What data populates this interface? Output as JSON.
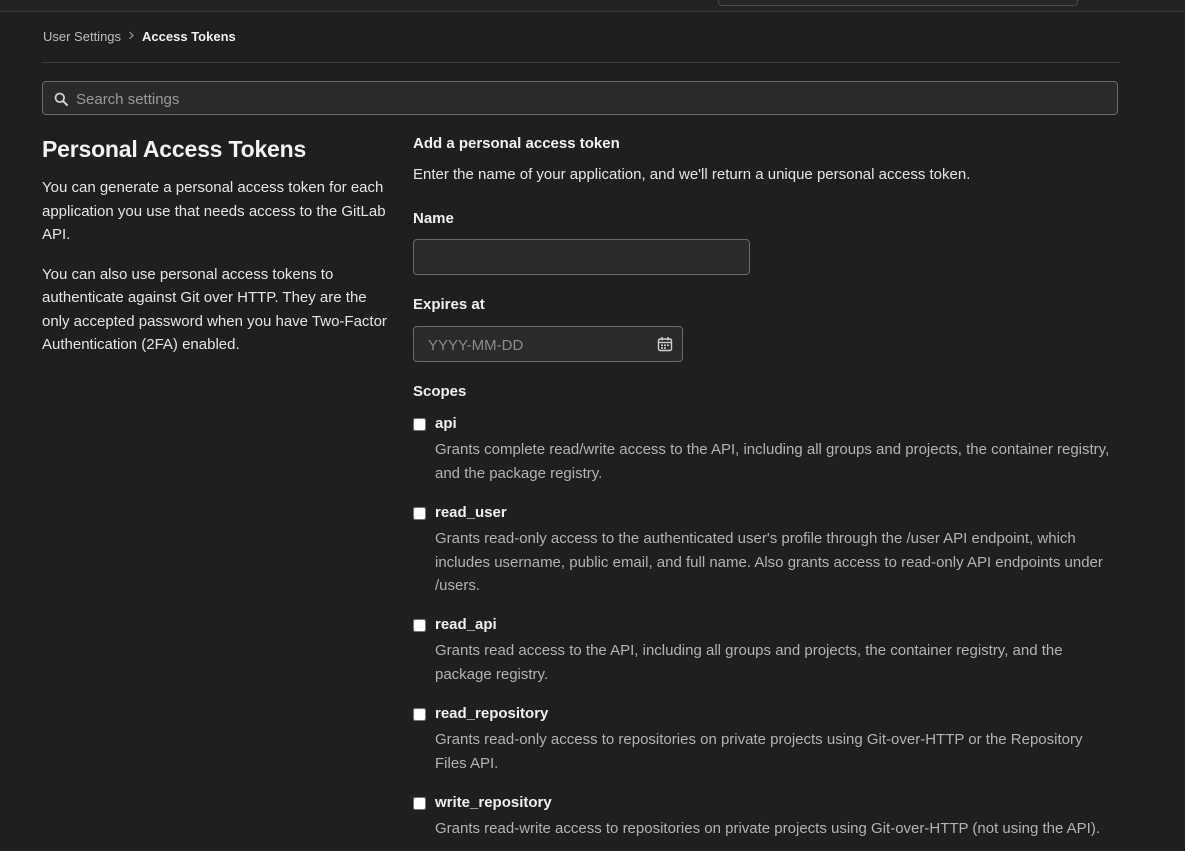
{
  "breadcrumb": {
    "parent": "User Settings",
    "current": "Access Tokens"
  },
  "search": {
    "placeholder": "Search settings",
    "value": ""
  },
  "intro": {
    "title": "Personal Access Tokens",
    "paragraphs": [
      "You can generate a personal access token for each application you use that needs access to the GitLab API.",
      "You can also use personal access tokens to authenticate against Git over HTTP. They are the only accepted password when you have Two-Factor Authentication (2FA) enabled."
    ]
  },
  "form": {
    "title": "Add a personal access token",
    "description": "Enter the name of your application, and we'll return a unique personal access token.",
    "name_label": "Name",
    "name_value": "",
    "expires_label": "Expires at",
    "expires_placeholder": "YYYY-MM-DD",
    "scopes_label": "Scopes",
    "scopes": [
      {
        "name": "api",
        "checked": false,
        "description": "Grants complete read/write access to the API, including all groups and projects, the container registry, and the package registry."
      },
      {
        "name": "read_user",
        "checked": false,
        "description": "Grants read-only access to the authenticated user's profile through the /user API endpoint, which includes username, public email, and full name. Also grants access to read-only API endpoints under /users."
      },
      {
        "name": "read_api",
        "checked": false,
        "description": "Grants read access to the API, including all groups and projects, the container registry, and the package registry."
      },
      {
        "name": "read_repository",
        "checked": false,
        "description": "Grants read-only access to repositories on private projects using Git-over-HTTP or the Repository Files API."
      },
      {
        "name": "write_repository",
        "checked": false,
        "description": "Grants read-write access to repositories on private projects using Git-over-HTTP (not using the API)."
      }
    ]
  },
  "icons": {
    "search": "search-icon",
    "calendar": "calendar-icon",
    "breadcrumb_separator": "chevron-right-icon"
  },
  "colors": {
    "background": "#1f1f1f",
    "text": "#ececec",
    "muted_text": "#b3b3b3",
    "input_border": "#6a6a6a"
  }
}
